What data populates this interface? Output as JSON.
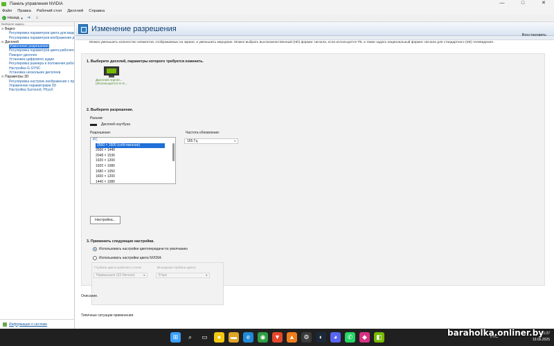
{
  "window": {
    "title": "Панель управления NVIDIA",
    "minimize": "—",
    "maximize": "□",
    "close": "✕"
  },
  "menu": [
    "Файл",
    "Правка",
    "Рабочий стол",
    "Дисплей",
    "Справка"
  ],
  "toolbar": {
    "back_label": "Назад",
    "dropdown": "▼",
    "forward_icon": "arrow-right-icon",
    "home_icon": "home-icon"
  },
  "sidebar": {
    "header": "Выберите задачу...",
    "tree": [
      {
        "type": "cat",
        "label": "Видео"
      },
      {
        "type": "item",
        "label": "Регулировка параметров цвета для видео"
      },
      {
        "type": "item",
        "label": "Регулировка параметров изображения для видео"
      },
      {
        "type": "cat",
        "label": "Дисплей"
      },
      {
        "type": "item",
        "label": "Изменение разрешения",
        "selected": true
      },
      {
        "type": "item",
        "label": "Регулировка параметров цвета рабочего стола"
      },
      {
        "type": "item",
        "label": "Поворот дисплея"
      },
      {
        "type": "item",
        "label": "Установка цифрового аудио"
      },
      {
        "type": "item",
        "label": "Регулировка размера и положения рабочего стола"
      },
      {
        "type": "item",
        "label": "Настройка G-SYNC"
      },
      {
        "type": "item",
        "label": "Установка нескольких дисплеев"
      },
      {
        "type": "cat",
        "label": "Параметры 3D"
      },
      {
        "type": "item",
        "label": "Регулировка настроек изображения с просмотром"
      },
      {
        "type": "item",
        "label": "Управление параметрами 3D"
      },
      {
        "type": "item",
        "label": "Настройка Surround, PhysX"
      }
    ],
    "info_link": "Информация о системе"
  },
  "content": {
    "title": "Изменение разрешения",
    "restore": "Восстановить",
    "description": "Можно уменьшить количество элементов, отображаемых на экране, и уменьшить мерцание. Можно выбрать высококачественный (HD) формат сигнала, если используется ТВ, а также задать национальный формат сигнала для стандартного (SD) телевидения.",
    "section1": {
      "title": "1. Выберите дисплей, параметры которого требуется изменить.",
      "display_line1": "Дисплей портат...",
      "display_line2": "(Используется G-S..."
    },
    "section2": {
      "title": "2. Выберите разрешение.",
      "connector_label": "Разъем:",
      "connector_value": "Дисплей ноутбука",
      "resolution_label": "Разрешение:",
      "refresh_label": "Частота обновления:",
      "refresh_value": "165 Гц",
      "group": "PC",
      "resolutions": [
        "2560 × 1600 (собственное)",
        "2560 × 1440",
        "2048 × 1536",
        "1920 × 1200",
        "1920 × 1080",
        "1680 × 1050",
        "1600 × 1200",
        "1440 × 1080"
      ],
      "selected_index": 0,
      "customize_button": "Настройка..."
    },
    "section3": {
      "title": "3. Применить следующие настройки.",
      "option_default": "Использовать настройки цветопередачи по умолчанию",
      "option_nvidia": "Использовать настройки цвета NVIDIA",
      "depth_label": "Глубина цвета рабочего стола:",
      "depth_value": "Наивысшее (32-битное)",
      "output_depth_label": "Выходная глубина цвета:",
      "output_depth_value": "8 bpc"
    },
    "description_label": "Описание.",
    "typical_label": "Типичные ситуации применения."
  },
  "taskbar": {
    "icons": [
      {
        "name": "start-icon",
        "glyph": "⊞",
        "color": "#3aa0ff"
      },
      {
        "name": "search-icon",
        "glyph": "⌕",
        "color": "#202020"
      },
      {
        "name": "task-view-icon",
        "glyph": "▭",
        "color": "#202020"
      },
      {
        "name": "app-yellow-icon",
        "glyph": "●",
        "color": "#f2c811"
      },
      {
        "name": "file-explorer-icon",
        "glyph": "▬",
        "color": "#e0a526"
      },
      {
        "name": "edge-icon",
        "glyph": "e",
        "color": "#1f8ad8"
      },
      {
        "name": "chrome-icon",
        "glyph": "◉",
        "color": "#2f9e44"
      },
      {
        "name": "brave-icon",
        "glyph": "▼",
        "color": "#e5472a"
      },
      {
        "name": "app-orange-icon",
        "glyph": "▲",
        "color": "#f07d1a"
      },
      {
        "name": "settings-icon",
        "glyph": "⚙",
        "color": "#3a3a3a"
      },
      {
        "name": "steam-icon",
        "glyph": "◐",
        "color": "#1b2838"
      },
      {
        "name": "discord-icon",
        "glyph": "◕",
        "color": "#5865f2"
      },
      {
        "name": "whatsapp-icon",
        "glyph": "✆",
        "color": "#25d366"
      },
      {
        "name": "app-pink-icon",
        "glyph": "◆",
        "color": "#d63384"
      },
      {
        "name": "nvidia-icon",
        "glyph": "◧",
        "color": "#76b900"
      }
    ],
    "language": "РУС",
    "time": "16:37",
    "date": "19.06.2025"
  },
  "watermark": "baraholka.onliner.by",
  "colors": {
    "accent": "#1e6fd9",
    "nvidia_green": "#76b900",
    "link": "#1a5ea8"
  }
}
